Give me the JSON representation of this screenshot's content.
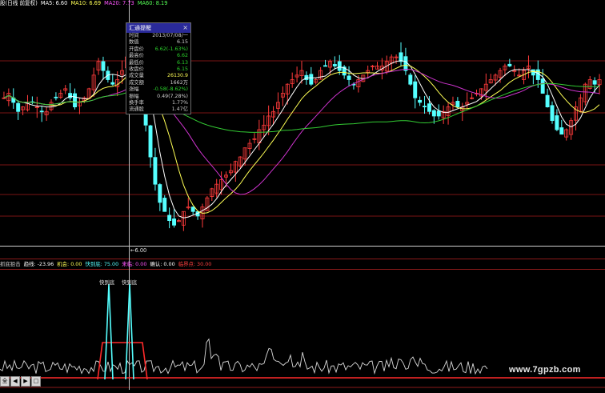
{
  "top_legend": {
    "title": "股(日线 前复权)",
    "ma": [
      {
        "label": "MA5: 6.60",
        "color": "#ffffff"
      },
      {
        "label": "MA10: 6.69",
        "color": "#ffff55"
      },
      {
        "label": "MA20: 7.73",
        "color": "#ff55ff"
      },
      {
        "label": "MA60: 8.19",
        "color": "#55ff55"
      }
    ]
  },
  "tooltip": {
    "title": "汇通提醒",
    "close": "×",
    "rows": [
      {
        "k": "时间",
        "v": "2013/07/08/一",
        "color": "#cfcfcf"
      },
      {
        "k": "数值",
        "v": "6.15",
        "color": "#cfcfcf"
      },
      {
        "k": "开盘价",
        "v": "6.62(-1.63%)",
        "color": "#2bd42b"
      },
      {
        "k": "最高价",
        "v": "6.62",
        "color": "#2bd42b"
      },
      {
        "k": "最低价",
        "v": "6.13",
        "color": "#2bd42b"
      },
      {
        "k": "收盘价",
        "v": "6.15",
        "color": "#2bd42b"
      },
      {
        "k": "成交量",
        "v": "26130.9",
        "color": "#ffff55"
      },
      {
        "k": "成交额",
        "v": "1662万",
        "color": "#cfcfcf"
      },
      {
        "k": "涨幅",
        "v": "-0.58(-8.62%)",
        "color": "#2bd42b"
      },
      {
        "k": "振幅",
        "v": "0.49(7.28%)",
        "color": "#cfcfcf"
      },
      {
        "k": "换手率",
        "v": "1.77%",
        "color": "#cfcfcf"
      },
      {
        "k": "流通股",
        "v": "1.47亿",
        "color": "#cfcfcf"
      }
    ]
  },
  "low_marker": "←6.00",
  "indicator_legend": [
    {
      "label": "抓底狙击",
      "color": "#cfcfcf"
    },
    {
      "label": "趋线: -23.96",
      "color": "#ffffff"
    },
    {
      "label": "机会: 0.00",
      "color": "#ffff55"
    },
    {
      "label": "快到底: 75.00",
      "color": "#55ffff"
    },
    {
      "label": "来临: 0.00",
      "color": "#ff55ff"
    },
    {
      "label": "确认: 0.00",
      "color": "#ffffff"
    },
    {
      "label": "临界点: 30.00",
      "color": "#ff4040"
    }
  ],
  "signal_labels": [
    "快到底",
    "快到底"
  ],
  "watermark": "www.7gpzb.com",
  "controls": [
    "全",
    "◀",
    "▶",
    "□"
  ],
  "colors": {
    "up": "#ff3b3b",
    "down": "#55ffff",
    "grid": "#7a1414",
    "ma5": "#ffffff",
    "ma10": "#ffff55",
    "ma20": "#cc33cc",
    "ma60": "#33cc33",
    "signal": "#ff2a2a"
  },
  "chart_data": [
    {
      "type": "candlestick",
      "description_series": [
        "close"
      ],
      "close": [
        7.55,
        7.6,
        7.5,
        7.4,
        7.45,
        7.5,
        7.5,
        7.45,
        7.4,
        7.4,
        7.5,
        7.55,
        7.6,
        7.65,
        7.55,
        7.45,
        7.5,
        7.55,
        7.65,
        7.8,
        7.95,
        7.85,
        7.75,
        7.7,
        7.75,
        7.85,
        8.0,
        8.1,
        7.95,
        7.6,
        7.25,
        6.9,
        6.6,
        6.4,
        6.3,
        6.2,
        6.15,
        6.2,
        6.3,
        6.35,
        6.3,
        6.25,
        6.35,
        6.45,
        6.55,
        6.6,
        6.65,
        6.7,
        6.75,
        6.85,
        6.9,
        7.0,
        7.05,
        7.1,
        7.2,
        7.25,
        7.35,
        7.4,
        7.5,
        7.6,
        7.7,
        7.75,
        7.8,
        7.85,
        7.75,
        7.7,
        7.75,
        7.85,
        7.9,
        7.95,
        7.9,
        7.85,
        7.8,
        7.75,
        7.7,
        7.75,
        7.8,
        7.85,
        7.9,
        7.9,
        7.9,
        7.95,
        8.0,
        8.0,
        7.95,
        7.85,
        7.7,
        7.55,
        7.5,
        7.45,
        7.4,
        7.35,
        7.35,
        7.4,
        7.45,
        7.5,
        7.45,
        7.45,
        7.5,
        7.55,
        7.6,
        7.65,
        7.7,
        7.75,
        7.8,
        7.85,
        7.9,
        7.9,
        7.85,
        7.8,
        7.85,
        7.9,
        7.8,
        7.75,
        7.6,
        7.45,
        7.3,
        7.2,
        7.15,
        7.2,
        7.3,
        7.45,
        7.55,
        7.7,
        7.75,
        7.7,
        7.75
      ],
      "ma_latest": {
        "MA5": 6.6,
        "MA10": 6.69,
        "MA20": 7.73,
        "MA60": 8.19
      },
      "annotated_low": 6.0
    },
    {
      "type": "line",
      "series": [
        {
          "name": "快到底",
          "values": [
            75,
            75
          ]
        },
        {
          "name": "临界点",
          "values": [
            30
          ]
        }
      ]
    }
  ]
}
